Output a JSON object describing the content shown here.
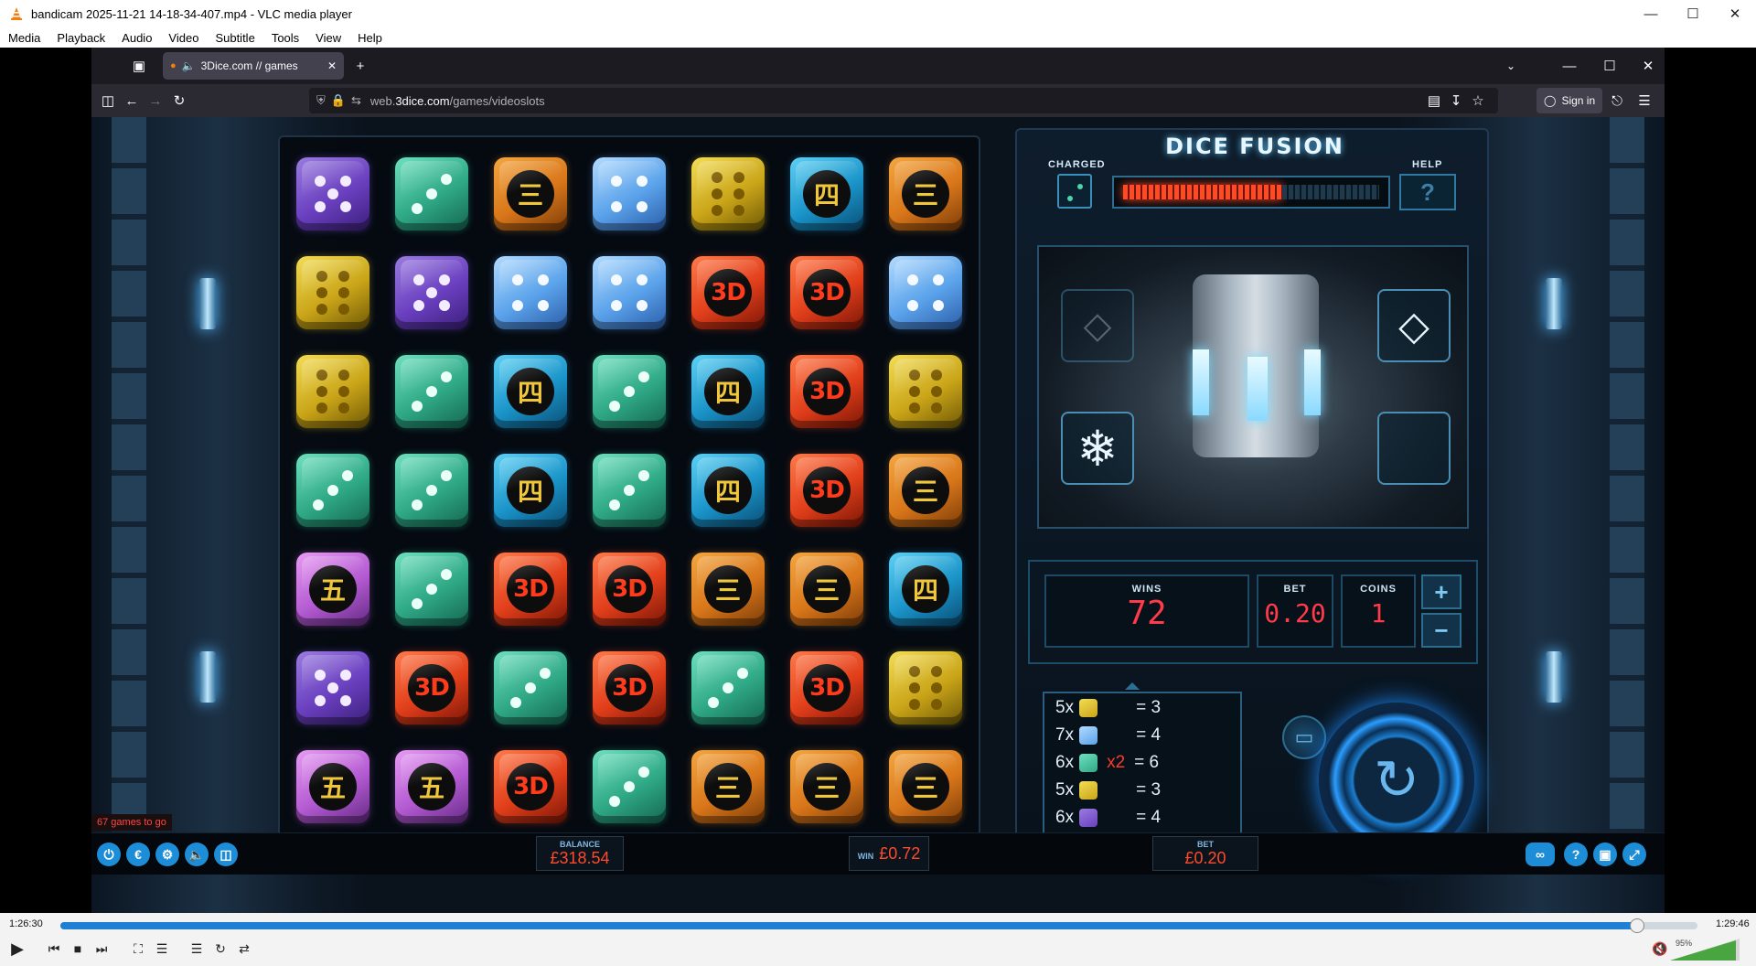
{
  "vlc": {
    "window_title": "bandicam 2025-11-21 14-18-34-407.mp4 - VLC media player",
    "menu": [
      "Media",
      "Playback",
      "Audio",
      "Video",
      "Subtitle",
      "Tools",
      "View",
      "Help"
    ],
    "time_current": "1:26:30",
    "time_total": "1:29:46",
    "progress_fraction": 0.963,
    "volume": "95%"
  },
  "browser": {
    "tab_title": "3Dice.com // games",
    "url_host": "web.",
    "url_domain": "3dice.com",
    "url_path": "/games/videoslots",
    "sign_in": "Sign in"
  },
  "game": {
    "title": "DICE FUSION",
    "charged_label": "CHARGED",
    "help_label": "HELP",
    "help_symbol": "?",
    "charge_fraction": 0.62,
    "wins_label": "WINS",
    "wins_value": "72",
    "bet_label": "BET",
    "bet_value": "0.20",
    "coins_label": "COINS",
    "coins_value": "1",
    "plus": "+",
    "minus": "−",
    "games_to_go": "67 games to go",
    "balance_label": "BALANCE",
    "balance_value": "£318.54",
    "win_label": "WIN",
    "win_value": "£0.72",
    "footer_bet_label": "BET",
    "footer_bet_value": "£0.20",
    "paytable": [
      {
        "count": "5x",
        "color": "yellow",
        "mult": "",
        "result": "= 3"
      },
      {
        "count": "7x",
        "color": "blue",
        "mult": "",
        "result": "= 4"
      },
      {
        "count": "6x",
        "color": "green",
        "mult": "x2",
        "result": "= 6"
      },
      {
        "count": "5x",
        "color": "yellow",
        "mult": "",
        "result": "= 3"
      },
      {
        "count": "6x",
        "color": "purple",
        "mult": "",
        "result": "= 4"
      }
    ],
    "grid": [
      [
        [
          "purple",
          "p5"
        ],
        [
          "green",
          "p3"
        ],
        [
          "orange",
          "三"
        ],
        [
          "blue",
          "p4"
        ],
        [
          "yellow",
          "p6"
        ],
        [
          "cyan",
          "四"
        ],
        [
          "orange",
          "三"
        ]
      ],
      [
        [
          "yellow",
          "p6"
        ],
        [
          "purple",
          "p5"
        ],
        [
          "blue",
          "p4"
        ],
        [
          "blue",
          "p4"
        ],
        [
          "red",
          "3D"
        ],
        [
          "red",
          "3D"
        ],
        [
          "blue",
          "p4"
        ]
      ],
      [
        [
          "yellow",
          "p6"
        ],
        [
          "green",
          "p3"
        ],
        [
          "cyan",
          "四"
        ],
        [
          "green",
          "p3"
        ],
        [
          "cyan",
          "四"
        ],
        [
          "red",
          "3D"
        ],
        [
          "yellow",
          "p6"
        ]
      ],
      [
        [
          "green",
          "p3"
        ],
        [
          "green",
          "p3"
        ],
        [
          "cyan",
          "四"
        ],
        [
          "green",
          "p3"
        ],
        [
          "cyan",
          "四"
        ],
        [
          "red",
          "3D"
        ],
        [
          "orange",
          "三"
        ]
      ],
      [
        [
          "violet",
          "五"
        ],
        [
          "green",
          "p3"
        ],
        [
          "red",
          "3D"
        ],
        [
          "red",
          "3D"
        ],
        [
          "orange",
          "三"
        ],
        [
          "orange",
          "三"
        ],
        [
          "cyan",
          "四"
        ]
      ],
      [
        [
          "purple",
          "p5"
        ],
        [
          "red",
          "3D"
        ],
        [
          "green",
          "p3"
        ],
        [
          "red",
          "3D"
        ],
        [
          "green",
          "p3"
        ],
        [
          "red",
          "3D"
        ],
        [
          "yellow",
          "p6"
        ]
      ],
      [
        [
          "violet",
          "五"
        ],
        [
          "violet",
          "五"
        ],
        [
          "red",
          "3D"
        ],
        [
          "green",
          "p3"
        ],
        [
          "orange",
          "三"
        ],
        [
          "orange",
          "三"
        ],
        [
          "orange",
          "三"
        ]
      ]
    ]
  }
}
